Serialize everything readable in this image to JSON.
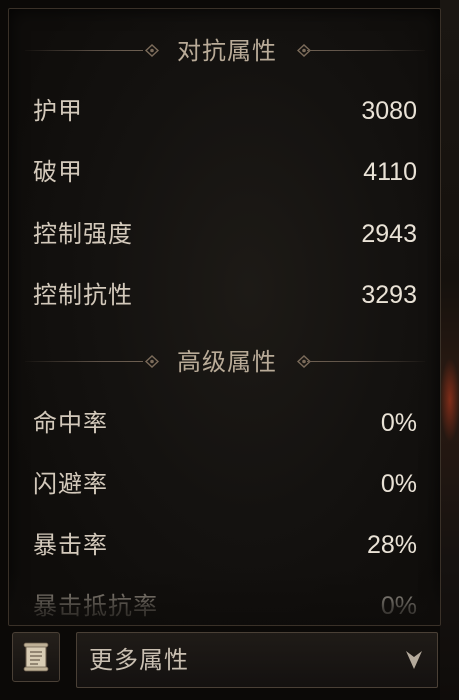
{
  "sections": [
    {
      "title": "对抗属性",
      "stats": [
        {
          "label": "护甲",
          "value": "3080"
        },
        {
          "label": "破甲",
          "value": "4110"
        },
        {
          "label": "控制强度",
          "value": "2943"
        },
        {
          "label": "控制抗性",
          "value": "3293"
        }
      ]
    },
    {
      "title": "高级属性",
      "stats": [
        {
          "label": "命中率",
          "value": "0%"
        },
        {
          "label": "闪避率",
          "value": "0%"
        },
        {
          "label": "暴击率",
          "value": "28%"
        },
        {
          "label": "暴击抵抗率",
          "value": "0%"
        }
      ]
    }
  ],
  "footer": {
    "book_icon": "scroll-icon",
    "dropdown_label": "更多属性",
    "dropdown_icon": "chevron-down-icon"
  },
  "colors": {
    "label": "#d3c9bb",
    "value": "#e9e2d6",
    "header": "#b9ab98",
    "panel_border": "#3a3128"
  }
}
